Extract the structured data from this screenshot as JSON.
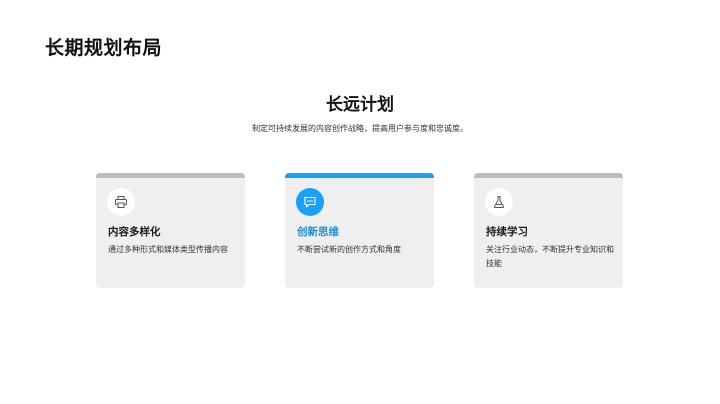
{
  "header": {
    "title": "长期规划布局"
  },
  "section": {
    "title": "长远计划",
    "subtitle": "制定可持续发展的内容创作战略，提高用户参与度和忠诚度。"
  },
  "cards": [
    {
      "heading": "内容多样化",
      "text": "通过多种形式和媒体类型传播内容",
      "icon": "printer-icon",
      "active": false
    },
    {
      "heading": "创新思维",
      "text": "不断尝试新的创作方式和角度",
      "icon": "chat-icon",
      "active": true
    },
    {
      "heading": "持续学习",
      "text": "关注行业动态，不断提升专业知识和技能",
      "icon": "flask-icon",
      "active": false
    }
  ],
  "colors": {
    "accent": "#1aa0ff",
    "accent_text": "#1a8fe0",
    "card_bg": "#efefef",
    "card_bar": "#bdbdbd"
  }
}
